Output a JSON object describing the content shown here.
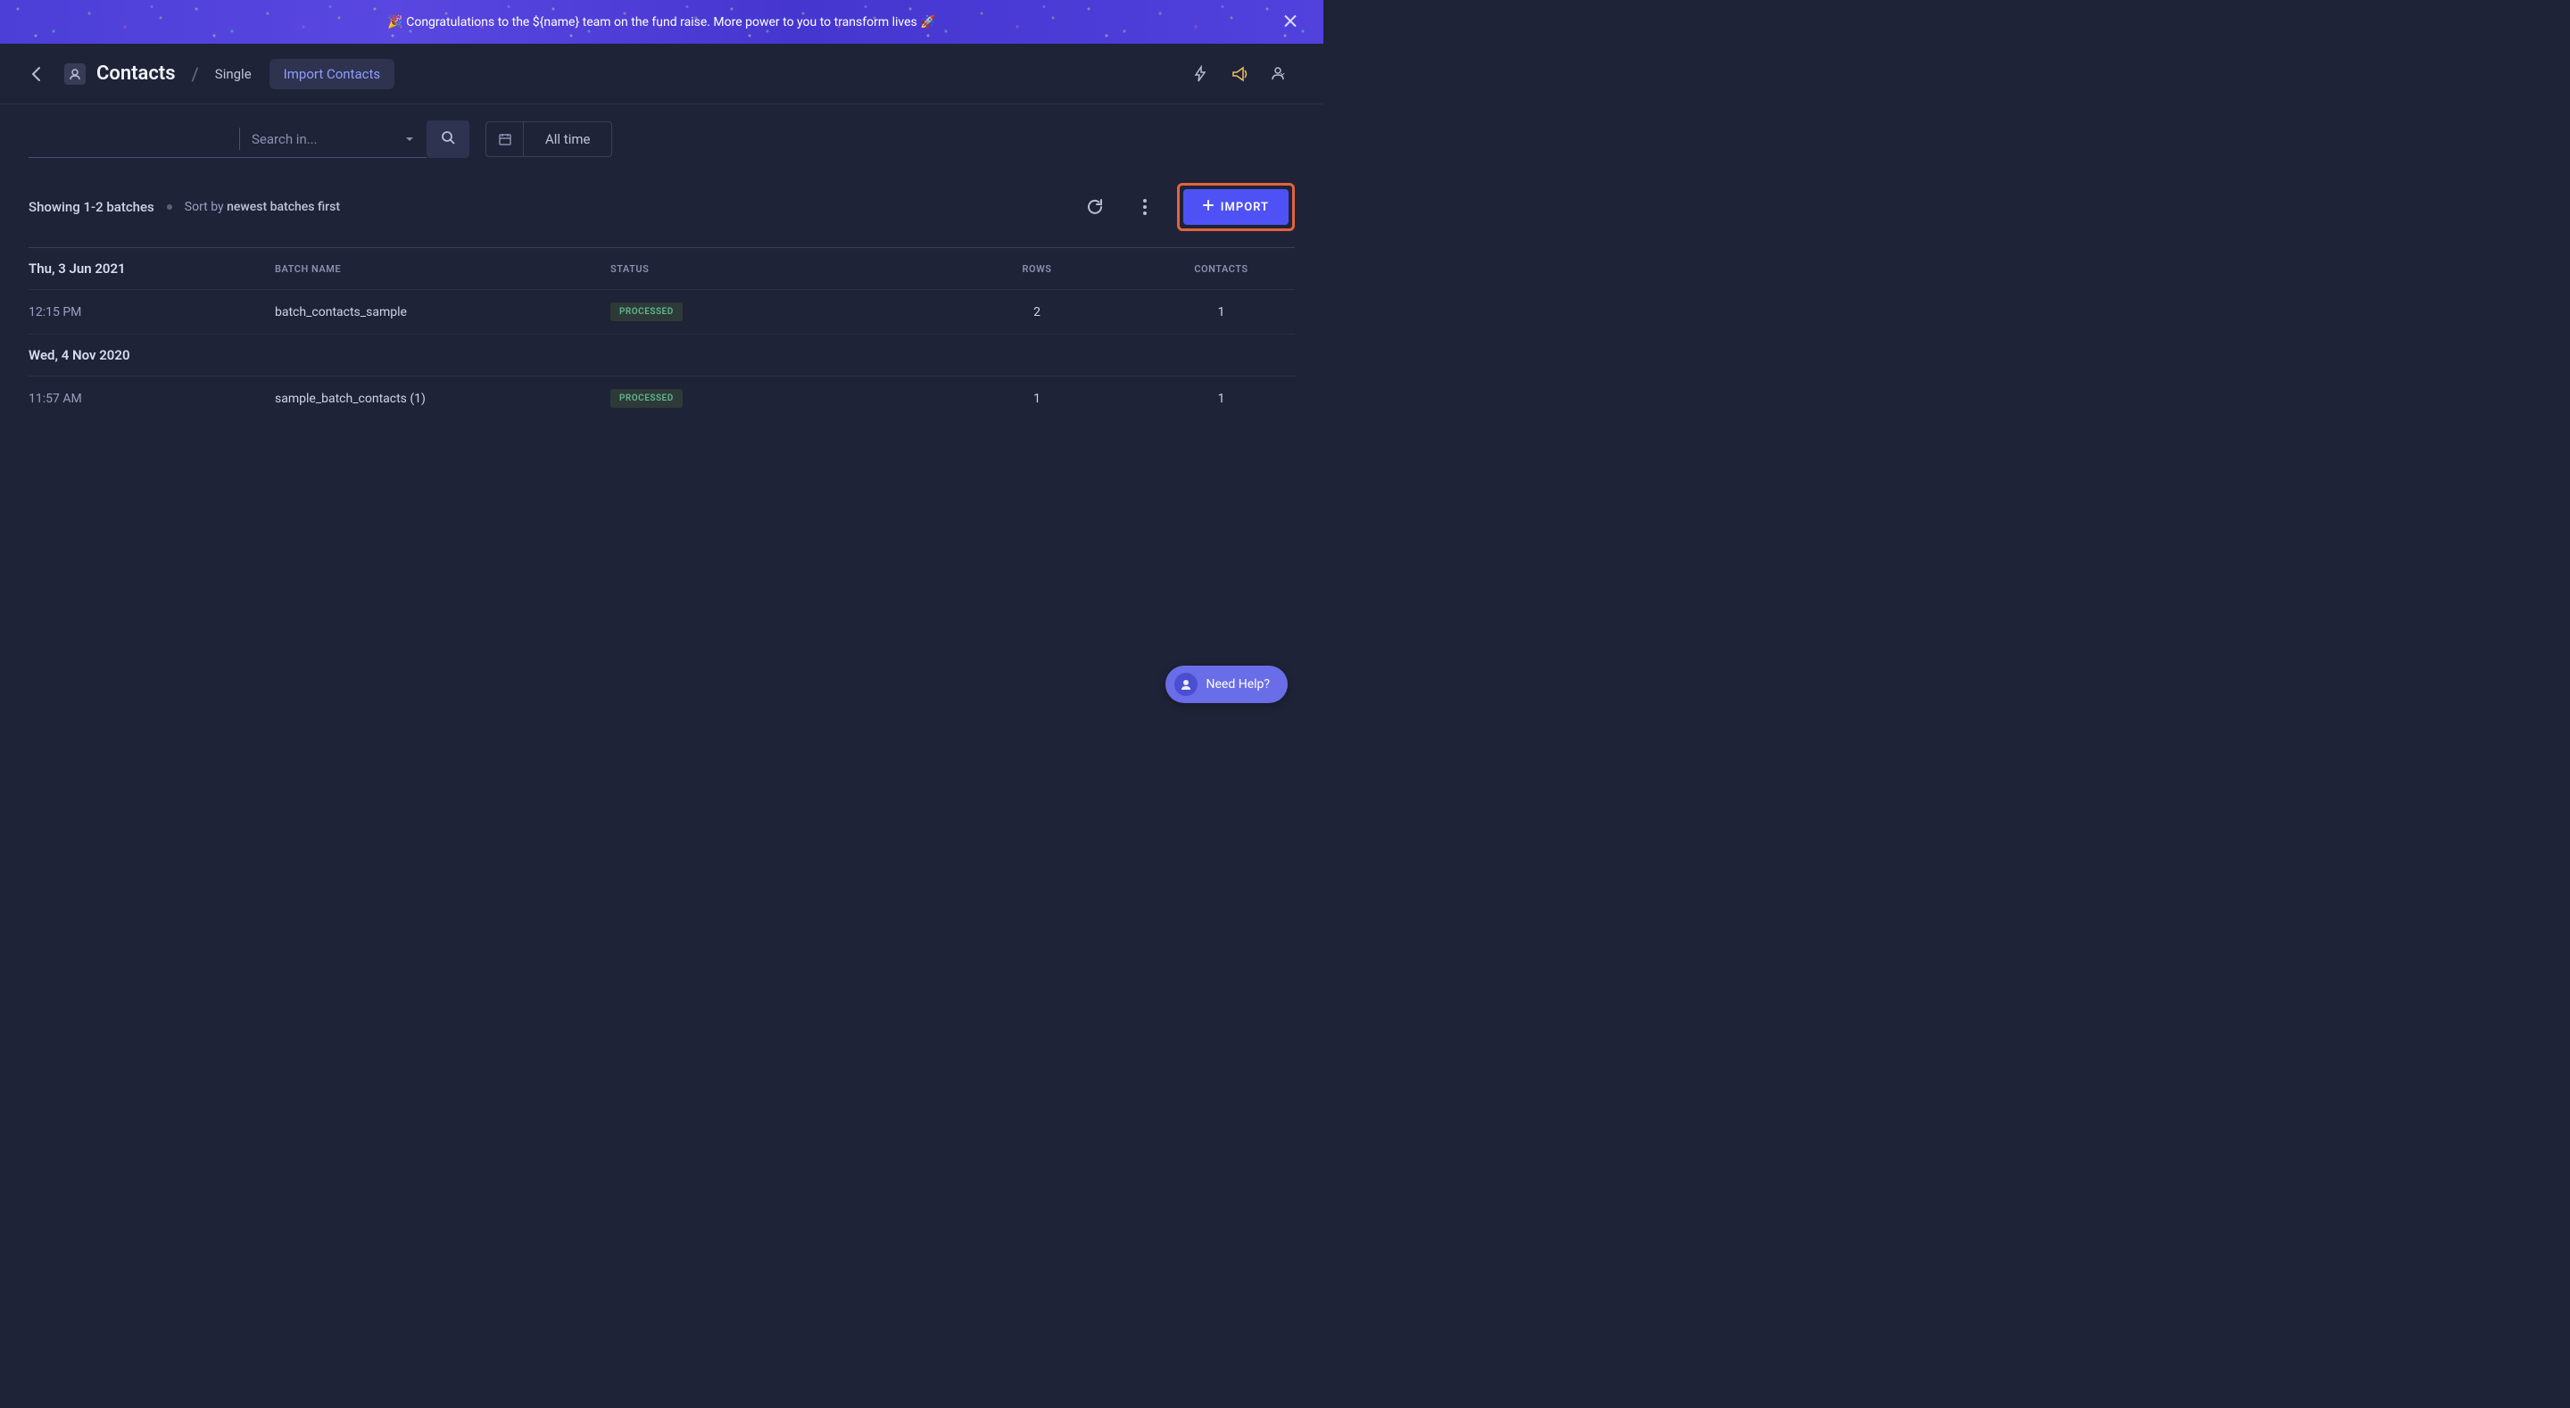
{
  "banner": {
    "text": "🎉 Congratulations to the ${name} team on the fund raise. More power to you to transform lives 🚀"
  },
  "breadcrumb": {
    "title": "Contacts",
    "tabs": [
      {
        "label": "Single",
        "active": false
      },
      {
        "label": "Import Contacts",
        "active": true
      }
    ]
  },
  "filters": {
    "search_placeholder": "Search in...",
    "date_range_label": "All time"
  },
  "toolbar": {
    "showing_text": "Showing 1-2 batches",
    "sort_prefix": "Sort by ",
    "sort_value": "newest batches first",
    "import_button_label": "IMPORT"
  },
  "table": {
    "headers": {
      "batch_name": "BATCH NAME",
      "status": "STATUS",
      "rows": "ROWS",
      "contacts": "CONTACTS"
    },
    "groups": [
      {
        "date_label": "Thu, 3 Jun 2021",
        "rows": [
          {
            "time": "12:15 PM",
            "name": "batch_contacts_sample",
            "status": "PROCESSED",
            "rows": "2",
            "contacts": "1"
          }
        ]
      },
      {
        "date_label": "Wed, 4 Nov 2020",
        "rows": [
          {
            "time": "11:57 AM",
            "name": "sample_batch_contacts (1)",
            "status": "PROCESSED",
            "rows": "1",
            "contacts": "1"
          }
        ]
      }
    ]
  },
  "help": {
    "label": "Need Help?"
  }
}
